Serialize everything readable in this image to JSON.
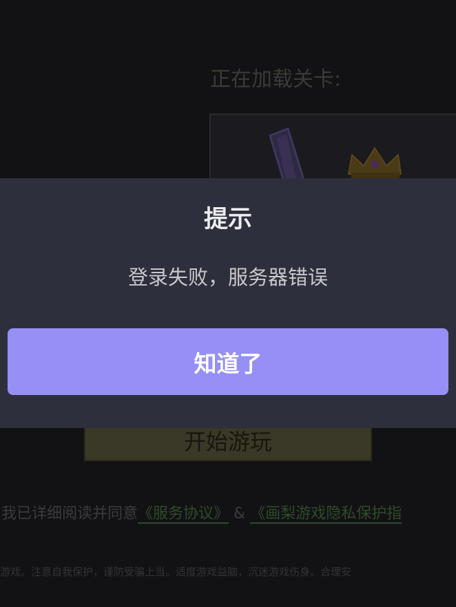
{
  "background": {
    "loading_label": "正在加载关卡:",
    "start_button": "开始游玩",
    "agreement": {
      "prefix": "我已详细阅读并同意",
      "service_link": "《服务协议》",
      "joiner": " & ",
      "privacy_link": "《画梨游戏隐私保护指"
    },
    "advisory": "游戏。注意自我保护，谨防受骗上当。适度游戏益脑，沉迷游戏伤身。合理安"
  },
  "dialog": {
    "title": "提示",
    "message": "登录失败，服务器错误",
    "confirm_label": "知道了"
  },
  "colors": {
    "dialog_bg": "#2e2f3c",
    "accent": "#968ff5"
  },
  "icons": [
    "crown-icon",
    "sword-icon"
  ]
}
